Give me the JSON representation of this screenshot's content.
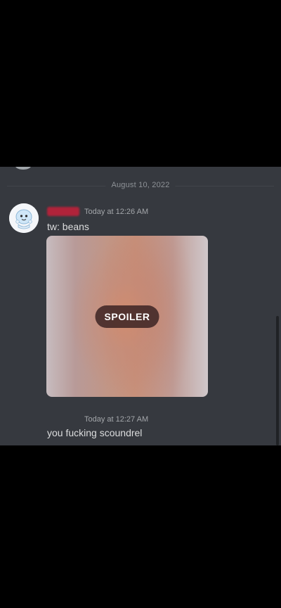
{
  "chat": {
    "date_divider": "August 10, 2022",
    "messages": [
      {
        "author_color": "#b0233a",
        "timestamp": "Today at 12:26 AM",
        "text": "tw: beans",
        "attachment": {
          "spoiler_label": "SPOILER",
          "icon": "spoiler-image"
        }
      },
      {
        "timestamp": "Today at 12:27 AM",
        "text": "you fucking scoundrel"
      }
    ]
  },
  "colors": {
    "background": "#36393f",
    "text": "#dcddde",
    "timestamp": "#a3a6aa",
    "divider": "#8e9297"
  }
}
